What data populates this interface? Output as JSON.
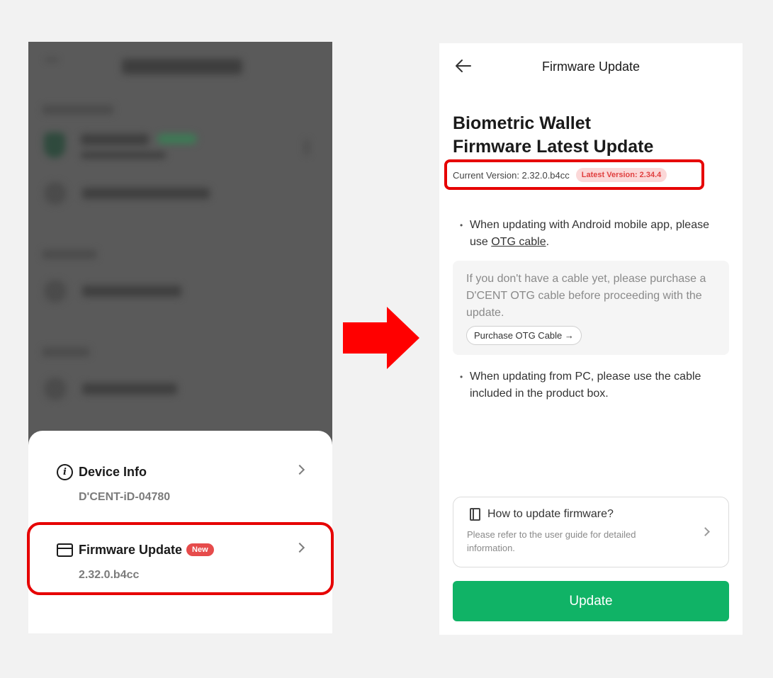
{
  "left_screen": {
    "device_info": {
      "title": "Device Info",
      "value": "D'CENT-iD-04780"
    },
    "firmware_update": {
      "title": "Firmware Update",
      "badge": "New",
      "value": "2.32.0.b4cc"
    }
  },
  "right_screen": {
    "nav_title": "Firmware Update",
    "heading_line1": "Biometric Wallet",
    "heading_line2": "Firmware Latest Update",
    "current_version": "Current Version: 2.32.0.b4cc",
    "latest_version": "Latest Version: 2.34.4",
    "bullet1_pre": "When updating with Android mobile app, please use ",
    "bullet1_link": "OTG cable",
    "bullet1_post": ".",
    "note_text": "If you don't have a cable yet, please purchase a D'CENT OTG cable before proceeding with the update.",
    "purchase_button": "Purchase OTG Cable →",
    "bullet2": "When updating from PC, please use the cable included in the product box.",
    "guide_title": "How to update firmware?",
    "guide_sub": "Please refer to the user guide for detailed information.",
    "update_button": "Update"
  },
  "colors": {
    "highlight": "#e60000",
    "badge_new": "#e64b4b",
    "primary_green": "#10b366",
    "arrow": "#ff0000"
  }
}
